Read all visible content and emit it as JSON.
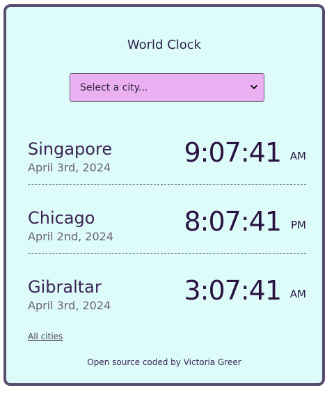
{
  "app": {
    "title": "World Clock"
  },
  "city_select": {
    "placeholder": "Select a city..."
  },
  "cities": [
    {
      "name": "Singapore",
      "date": "April 3rd, 2024",
      "time": "9:07:41",
      "ampm": "AM"
    },
    {
      "name": "Chicago",
      "date": "April 2nd, 2024",
      "time": "8:07:41",
      "ampm": "PM"
    },
    {
      "name": "Gibraltar",
      "date": "April 3rd, 2024",
      "time": "3:07:41",
      "ampm": "AM"
    }
  ],
  "links": {
    "all_cities": "All cities"
  },
  "footer": {
    "text": "Open source coded by Victoria Greer"
  },
  "colors": {
    "card_background": "#ddfbf9",
    "card_border": "#5b4d70",
    "select_background": "#ebb0f1",
    "text_dark": "#2a1241"
  },
  "icons": {
    "select_chevron": "chevron-down-icon"
  }
}
